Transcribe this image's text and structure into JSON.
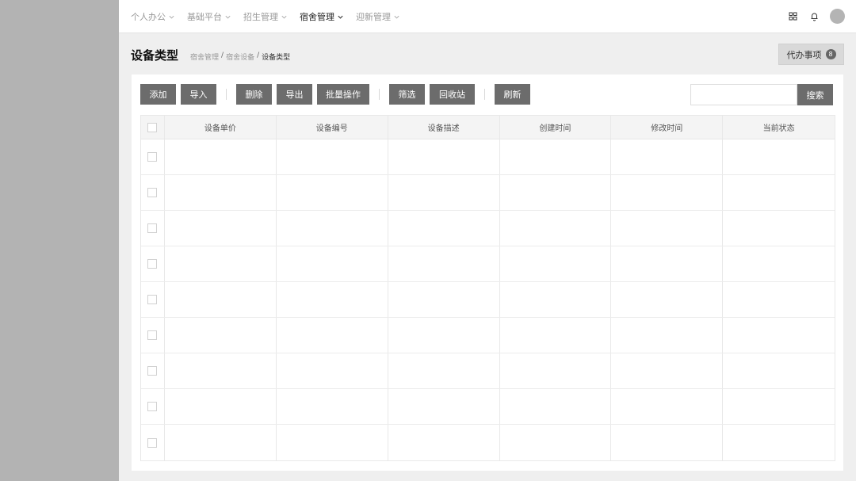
{
  "nav": {
    "items": [
      {
        "label": "个人办公",
        "active": false
      },
      {
        "label": "基础平台",
        "active": false
      },
      {
        "label": "招生管理",
        "active": false
      },
      {
        "label": "宿舍管理",
        "active": true
      },
      {
        "label": "迎新管理",
        "active": false
      }
    ]
  },
  "topbar": {
    "icons": [
      "apps-grid-icon",
      "bell-icon",
      "avatar"
    ]
  },
  "header": {
    "title": "设备类型",
    "breadcrumb": [
      "宿舍管理",
      "宿舍设备",
      "设备类型"
    ],
    "todo_label": "代办事项",
    "todo_count": "8"
  },
  "toolbar": {
    "add": "添加",
    "import": "导入",
    "delete": "删除",
    "export": "导出",
    "batch": "批量操作",
    "filter": "筛选",
    "recycle": "回收站",
    "refresh": "刷新"
  },
  "search": {
    "placeholder": "",
    "button": "搜索"
  },
  "table": {
    "columns": [
      "设备单价",
      "设备编号",
      "设备描述",
      "创建时间",
      "修改时间",
      "当前状态"
    ],
    "row_count": 9
  },
  "colors": {
    "button_bg": "#6c6c6c",
    "sidebar_bg": "#b3b3b3",
    "content_bg": "#efefef"
  }
}
